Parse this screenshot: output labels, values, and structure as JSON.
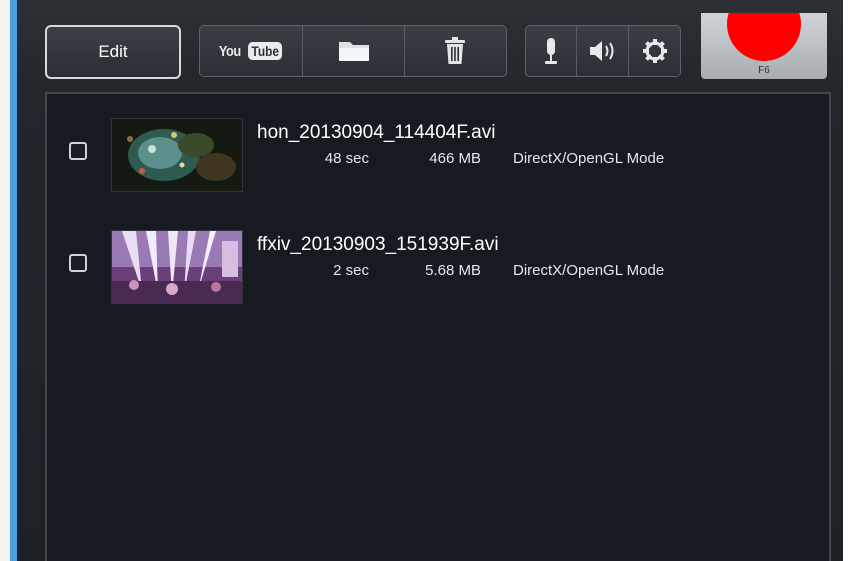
{
  "toolbar": {
    "edit_label": "Edit",
    "youtube_label_you": "You",
    "youtube_label_tube": "Tube",
    "record_hotkey": "F6"
  },
  "colors": {
    "accent_blue": "#4da0e0",
    "record_red": "#ff0000",
    "panel_bg": "#171b21"
  },
  "icons": [
    "youtube-icon",
    "folder-icon",
    "trash-icon",
    "microphone-icon",
    "speaker-icon",
    "gear-icon",
    "record-icon"
  ],
  "recordings": [
    {
      "filename": "hon_20130904_114404F.avi",
      "duration": "48 sec",
      "size": "466 MB",
      "mode": "DirectX/OpenGL Mode",
      "checked": false
    },
    {
      "filename": "ffxiv_20130903_151939F.avi",
      "duration": "2 sec",
      "size": "5.68 MB",
      "mode": "DirectX/OpenGL Mode",
      "checked": false
    }
  ]
}
